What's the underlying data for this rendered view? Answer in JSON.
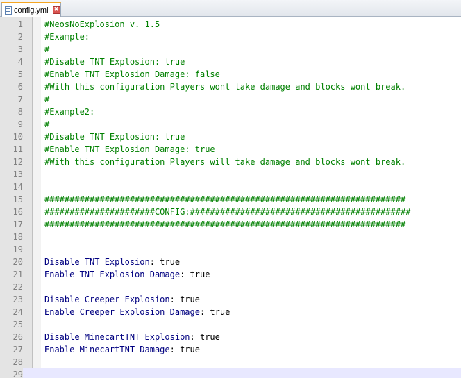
{
  "tab": {
    "label": "config.yml",
    "close_glyph": "✖",
    "icon": "file-icon"
  },
  "editor": {
    "current_line": 29,
    "lines": [
      {
        "n": "1",
        "type": "comment",
        "text": "#NeosNoExplosion v. 1.5"
      },
      {
        "n": "2",
        "type": "comment",
        "text": "#Example:"
      },
      {
        "n": "3",
        "type": "comment",
        "text": "#"
      },
      {
        "n": "4",
        "type": "comment",
        "text": "#Disable TNT Explosion: true"
      },
      {
        "n": "5",
        "type": "comment",
        "text": "#Enable TNT Explosion Damage: false"
      },
      {
        "n": "6",
        "type": "comment",
        "text": "#With this configuration Players wont take damage and blocks wont break."
      },
      {
        "n": "7",
        "type": "comment",
        "text": "#"
      },
      {
        "n": "8",
        "type": "comment",
        "text": "#Example2:"
      },
      {
        "n": "9",
        "type": "comment",
        "text": "#"
      },
      {
        "n": "10",
        "type": "comment",
        "text": "#Disable TNT Explosion: true"
      },
      {
        "n": "11",
        "type": "comment",
        "text": "#Enable TNT Explosion Damage: true"
      },
      {
        "n": "12",
        "type": "comment",
        "text": "#With this configuration Players will take damage and blocks wont break."
      },
      {
        "n": "13",
        "type": "blank",
        "text": ""
      },
      {
        "n": "14",
        "type": "blank",
        "text": ""
      },
      {
        "n": "15",
        "type": "comment",
        "text": "########################################################################"
      },
      {
        "n": "16",
        "type": "comment",
        "text": "######################CONFIG:############################################"
      },
      {
        "n": "17",
        "type": "comment",
        "text": "########################################################################"
      },
      {
        "n": "18",
        "type": "blank",
        "text": ""
      },
      {
        "n": "19",
        "type": "blank",
        "text": ""
      },
      {
        "n": "20",
        "type": "kv",
        "key": "Disable TNT Explosion",
        "value": "true"
      },
      {
        "n": "21",
        "type": "kv",
        "key": "Enable TNT Explosion Damage",
        "value": "true"
      },
      {
        "n": "22",
        "type": "blank",
        "text": ""
      },
      {
        "n": "23",
        "type": "kv",
        "key": "Disable Creeper Explosion",
        "value": "true"
      },
      {
        "n": "24",
        "type": "kv",
        "key": "Enable Creeper Explosion Damage",
        "value": "true"
      },
      {
        "n": "25",
        "type": "blank",
        "text": ""
      },
      {
        "n": "26",
        "type": "kv",
        "key": "Disable MinecartTNT Explosion",
        "value": "true"
      },
      {
        "n": "27",
        "type": "kv",
        "key": "Enable MinecartTNT Damage",
        "value": "true"
      },
      {
        "n": "28",
        "type": "blank",
        "text": ""
      },
      {
        "n": "29",
        "type": "blank",
        "text": ""
      }
    ]
  }
}
